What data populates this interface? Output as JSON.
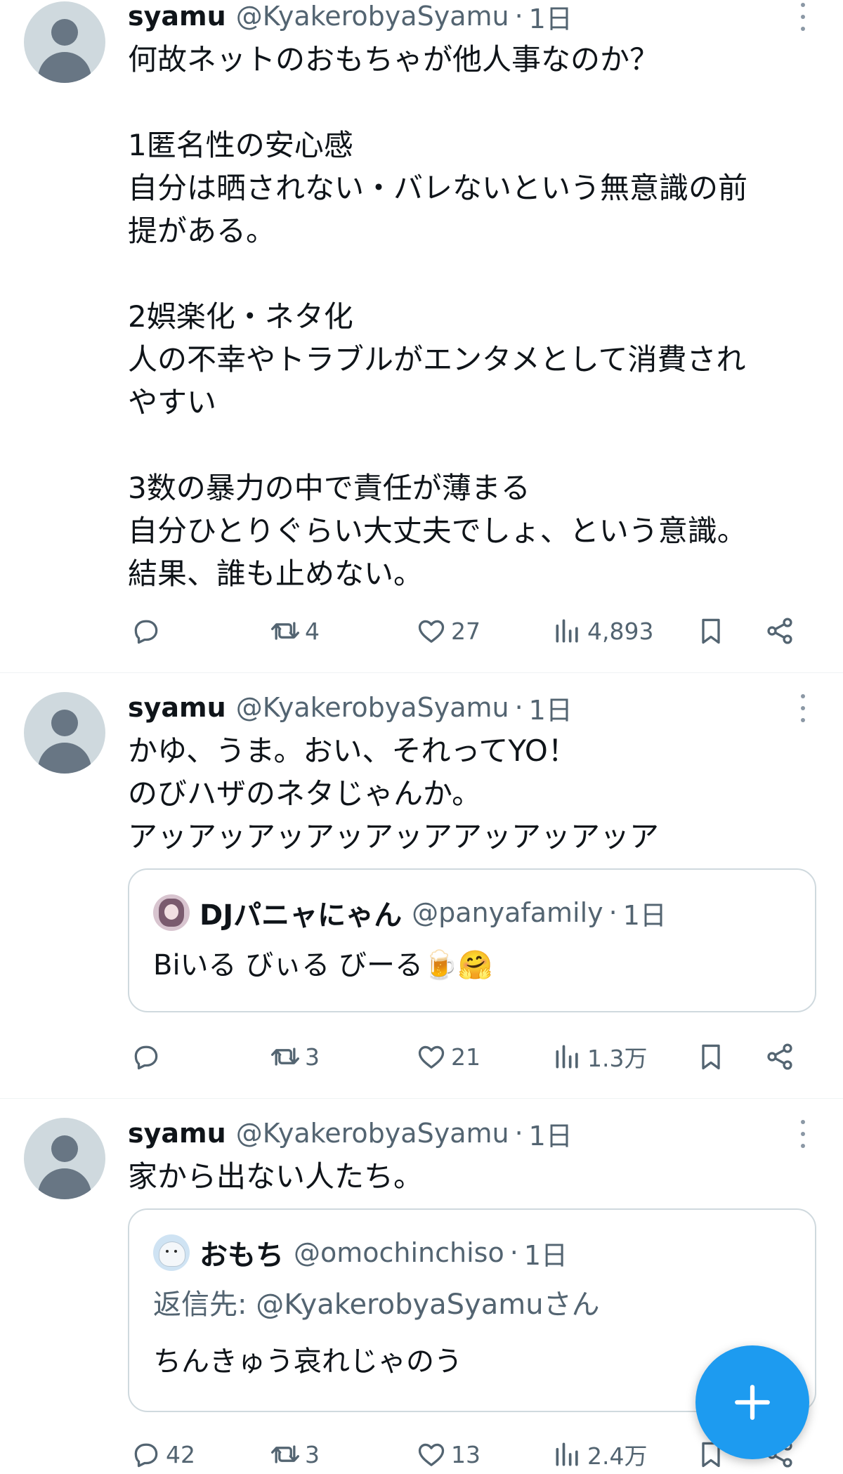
{
  "tweets": [
    {
      "name": "syamu",
      "handle": "@KyakerobyaSyamu",
      "dot": "·",
      "time": "1日",
      "lines": [
        "何故ネットのおもちゃが他人事なのか？",
        "",
        "1匿名性の安心感",
        "自分は晒されない・バレないという無意識の前",
        "提がある。",
        "",
        "2娯楽化・ネタ化",
        "人の不幸やトラブルがエンタメとして消費され",
        "やすい",
        "",
        "3数の暴力の中で責任が薄まる",
        "自分ひとりぐらい大丈夫でしょ、という意識。",
        "結果、誰も止めない。"
      ],
      "stats": {
        "replies": "",
        "retweets": "4",
        "likes": "27",
        "views": "4,893"
      }
    },
    {
      "name": "syamu",
      "handle": "@KyakerobyaSyamu",
      "dot": "·",
      "time": "1日",
      "lines": [
        "かゆ、うま。おい、それってYO！",
        "のびハザのネタじゃんか。",
        "アッアッアッアッアッアアッアッアッア"
      ],
      "quote": {
        "name": "DJパニャにゃん",
        "handle": "@panyafamily",
        "dot": "·",
        "time": "1日",
        "text": "Biいる びぃる びーる🍺🤗"
      },
      "stats": {
        "replies": "",
        "retweets": "3",
        "likes": "21",
        "views": "1.3万"
      }
    },
    {
      "name": "syamu",
      "handle": "@KyakerobyaSyamu",
      "dot": "·",
      "time": "1日",
      "lines": [
        "家から出ない人たち。"
      ],
      "quote": {
        "name": "おもち",
        "handle": "@omochinchiso",
        "dot": "·",
        "time": "1日",
        "replying_prefix": "返信先: ",
        "replying_handle": "@KyakerobyaSyamu",
        "replying_suffix": "さん",
        "text": "ちんきゅう哀れじゃのう"
      },
      "stats": {
        "replies": "42",
        "retweets": "3",
        "likes": "13",
        "views": "2.4万"
      }
    }
  ],
  "colors": {
    "text": "#0f1419",
    "muted": "#536471",
    "accent": "#1d9bf0",
    "border": "#cfd9de"
  },
  "icons": [
    "reply-icon",
    "retweet-icon",
    "like-icon",
    "views-icon",
    "bookmark-icon",
    "share-icon",
    "more-icon",
    "compose-plus-icon"
  ]
}
